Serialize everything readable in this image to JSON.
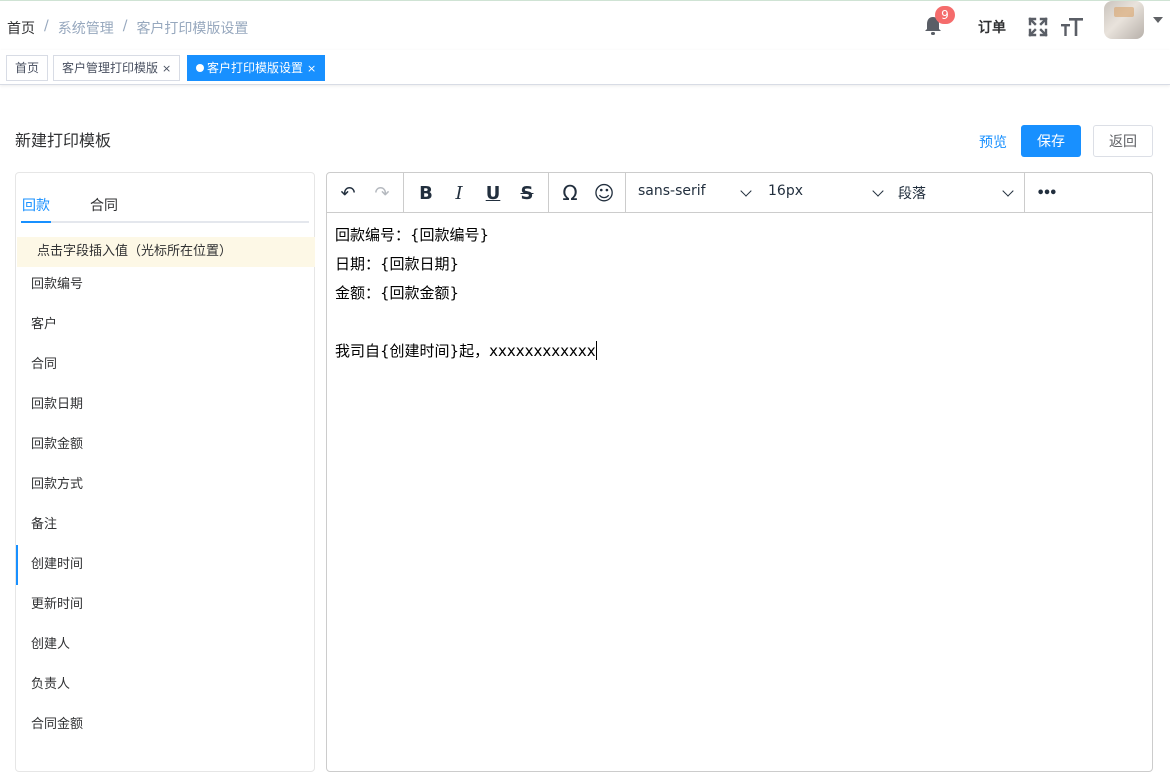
{
  "breadcrumb": {
    "items": [
      "首页",
      "系统管理",
      "客户打印模版设置"
    ],
    "separator": "/"
  },
  "navbar": {
    "notification_count": "9",
    "order_label": "订单",
    "icons": [
      "bell-icon",
      "fullscreen-icon",
      "text-size-icon",
      "avatar",
      "caret-down-icon"
    ]
  },
  "tags": [
    {
      "label": "首页",
      "active": false,
      "closable": false
    },
    {
      "label": "客户管理打印模版",
      "active": false,
      "closable": true
    },
    {
      "label": "客户打印模版设置",
      "active": true,
      "closable": true
    }
  ],
  "tag_close_glyph": "×",
  "page": {
    "title": "新建打印模板",
    "preview_label": "预览",
    "save_label": "保存",
    "back_label": "返回"
  },
  "left_panel": {
    "tabs": [
      "回款",
      "合同"
    ],
    "active_tab": "回款",
    "hint": "点击字段插入值（光标所在位置）",
    "fields": [
      "回款编号",
      "客户",
      "合同",
      "回款日期",
      "回款金额",
      "回款方式",
      "备注",
      "创建时间",
      "更新时间",
      "创建人",
      "负责人",
      "合同金额"
    ],
    "highlighted_field": "创建时间"
  },
  "editor": {
    "toolbar": {
      "undo": "↶",
      "redo": "↷",
      "bold": "B",
      "italic": "I",
      "underline": "U",
      "strike": "S",
      "special_char": "Ω",
      "emoji": "☺",
      "more": "•••",
      "font_family": "sans-serif",
      "font_size": "16px",
      "block_format": "段落"
    },
    "lines": [
      "回款编号：{回款编号}",
      "日期：{回款日期}",
      "金额：{回款金额}",
      "",
      "我司自{创建时间}起，xxxxxxxxxxxx"
    ]
  },
  "colors": {
    "primary": "#1890ff",
    "badge": "#f56c6c",
    "hint_bg": "#fdf8e6"
  }
}
